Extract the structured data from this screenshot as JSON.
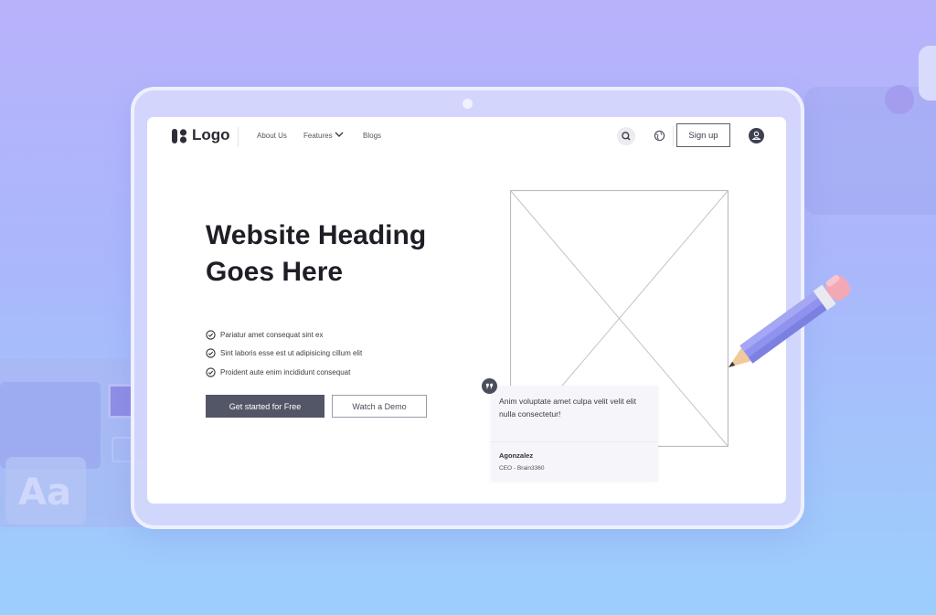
{
  "nav": {
    "logo_text": "Logo",
    "links": [
      {
        "label": "About Us"
      },
      {
        "label": "Features"
      },
      {
        "label": "Blogs"
      }
    ],
    "signup_label": "Sign up"
  },
  "hero": {
    "heading_line1": "Website Heading",
    "heading_line2": "Goes Here",
    "features": [
      "Pariatur amet consequat sint ex",
      "Sint laboris esse est ut adipisicing cillum elit",
      "Proident aute enim incididunt consequat"
    ],
    "cta_primary": "Get started for Free",
    "cta_secondary": "Watch a Demo"
  },
  "testimonial": {
    "quote": "Anim voluptate amet culpa velit velit elit nulla consectetur!",
    "name": "Agonzalez",
    "role": "CEO - Brain3360"
  },
  "background": {
    "decor_letter": "Aa"
  },
  "colors": {
    "accent_dark": "#535667",
    "pencil_body": "#8f92ee",
    "eraser": "#f3a8b6"
  },
  "icons": [
    "logo-mark-icon",
    "chevron-down-icon",
    "search-icon",
    "globe-icon",
    "user-icon",
    "check-circle-icon",
    "quote-icon",
    "image-placeholder-icon",
    "pencil-icon"
  ]
}
